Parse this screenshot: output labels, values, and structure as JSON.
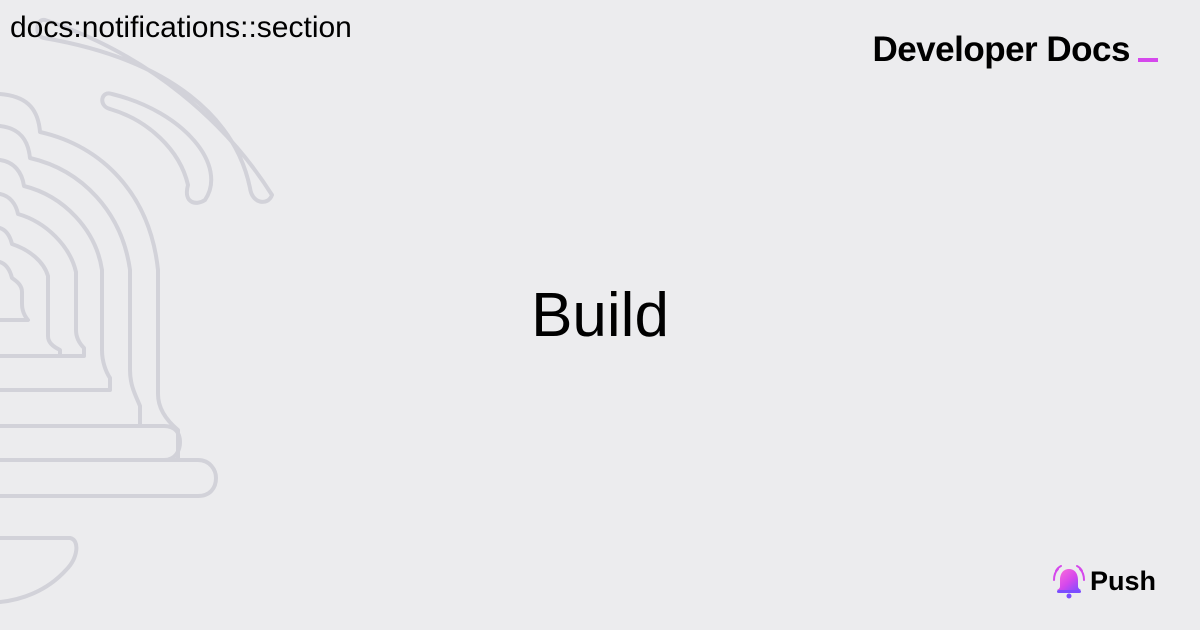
{
  "header": {
    "section_label": "docs:notifications::section"
  },
  "brand": {
    "title": "Developer Docs",
    "accent_color": "#d548ec"
  },
  "main": {
    "title": "Build"
  },
  "footer": {
    "logo_text": "Push",
    "logo_icon": "bell-icon"
  },
  "decoration": {
    "icon": "bell-outline-icon",
    "stroke_color": "#d3d3da"
  }
}
